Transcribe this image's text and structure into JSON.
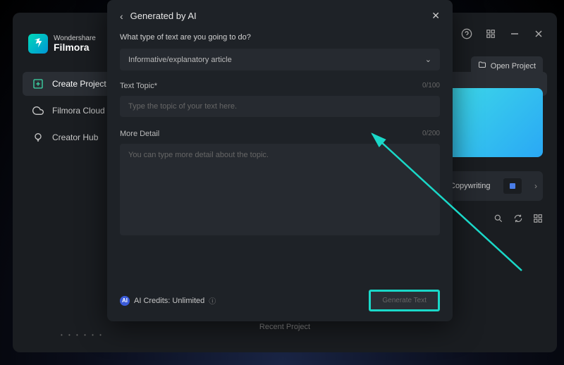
{
  "logo": {
    "brand": "Wondershare",
    "product": "Filmora"
  },
  "sidebar": {
    "items": [
      {
        "label": "Create Project"
      },
      {
        "label": "Filmora Cloud"
      },
      {
        "label": "Creator Hub"
      }
    ]
  },
  "right": {
    "open_project": "Open Project",
    "copywriting": "Copywriting"
  },
  "recent_label": "Recent Project",
  "modal": {
    "title": "Generated by AI",
    "q1": "What type of text are you going to do?",
    "select_value": "Informative/explanatory article",
    "topic_label": "Text Topic*",
    "topic_count": "0/100",
    "topic_placeholder": "Type the topic of your text here.",
    "detail_label": "More Detail",
    "detail_count": "0/200",
    "detail_placeholder": "You can type more detail about the topic.",
    "credits_label": "AI Credits: Unlimited",
    "generate_label": "Generate Text"
  }
}
